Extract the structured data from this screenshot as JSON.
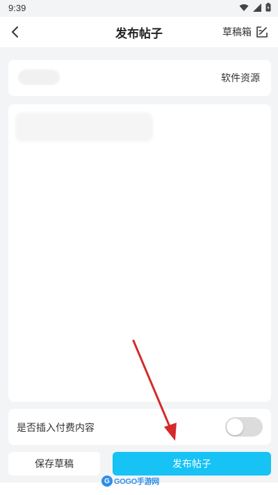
{
  "status_bar": {
    "time": "9:39",
    "icons": [
      "wifi-icon",
      "signal-icon",
      "battery-icon"
    ]
  },
  "header": {
    "title": "发布帖子",
    "drafts_label": "草稿箱",
    "back_icon": "chevron-left-icon",
    "drafts_icon": "edit-note-icon"
  },
  "resource": {
    "category": "软件资源"
  },
  "paid_content": {
    "label": "是否插入付费内容",
    "enabled": false
  },
  "actions": {
    "save_label": "保存草稿",
    "publish_label": "发布帖子"
  },
  "watermark": {
    "logo": "G",
    "text": "GOGO手游网"
  },
  "colors": {
    "accent": "#17c2f4",
    "annotation_arrow": "#d42a2a",
    "background": "#f3f4f6",
    "watermark": "#2f8ee8"
  }
}
